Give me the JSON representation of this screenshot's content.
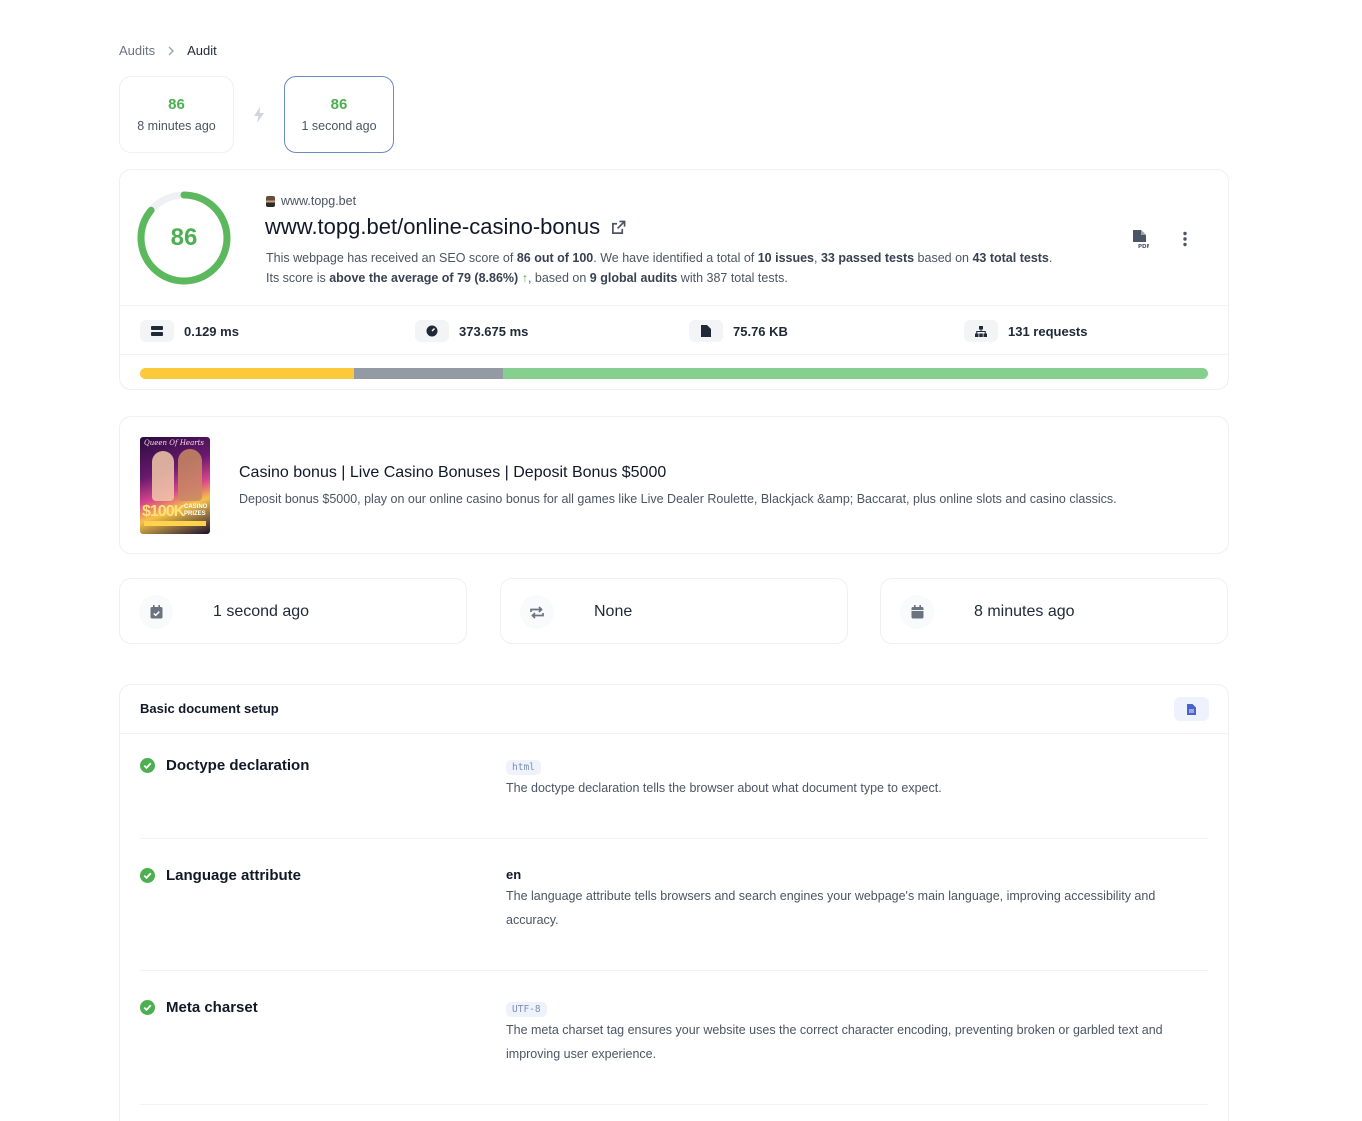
{
  "breadcrumb": {
    "parent": "Audits",
    "current": "Audit"
  },
  "history": [
    {
      "score": "86",
      "time": "8 minutes ago"
    },
    {
      "score": "86",
      "time": "1 second ago"
    }
  ],
  "summary": {
    "score": "86",
    "score_fraction": 0.86,
    "site": "www.topg.bet",
    "url": "www.topg.bet/online-casino-bonus",
    "line1": {
      "p1": "This webpage has received an SEO score of ",
      "b1": "86 out of 100",
      "p2": ". We have identified a total of ",
      "b2": "10 issues",
      "p3": ", ",
      "b3": "33 passed tests",
      "p4": " based on ",
      "b4": "43 total tests",
      "p5": "."
    },
    "line2": {
      "p1": "Its score is ",
      "b1": "above the average of 79 (8.86%)",
      "arrow": "↑",
      "p2": ", based on ",
      "b2": "9 global audits",
      "p3": " with 387 total tests."
    },
    "metrics": [
      {
        "icon": "server-icon",
        "value": "0.129 ms"
      },
      {
        "icon": "gauge-icon",
        "value": "373.675 ms"
      },
      {
        "icon": "file-icon",
        "value": "75.76 KB"
      },
      {
        "icon": "sitemap-icon",
        "value": "131 requests"
      }
    ],
    "issue_bar": {
      "issues": 10,
      "warnings": 7,
      "passed": 33
    }
  },
  "meta": {
    "thumb_text_top": "Queen Of Hearts",
    "thumb_amount": "$100K",
    "thumb_prizes": "CASINO PRIZES",
    "title": "Casino bonus | Live Casino Bonuses | Deposit Bonus $5000",
    "description": "Deposit bonus $5000, play on our online casino bonus for all games like Live Dealer Roulette, Blackjack &amp; Baccarat, plus online slots and casino classics."
  },
  "info_cards": [
    {
      "icon": "calendar-check-icon",
      "text": "1 second ago"
    },
    {
      "icon": "repeat-icon",
      "text": "None"
    },
    {
      "icon": "calendar-icon",
      "text": "8 minutes ago"
    }
  ],
  "section": {
    "title": "Basic document setup",
    "checks": [
      {
        "name": "Doctype declaration",
        "value": "html",
        "value_style": "code",
        "description": "The doctype declaration tells the browser about what document type to expect."
      },
      {
        "name": "Language attribute",
        "value": "en",
        "value_style": "plain",
        "description": "The language attribute tells browsers and search engines your webpage's main language, improving accessibility and accuracy."
      },
      {
        "name": "Meta charset",
        "value": "UTF-8",
        "value_style": "code",
        "description": "The meta charset tag ensures your website uses the correct character encoding, preventing broken or garbled text and improving user experience."
      }
    ]
  },
  "colors": {
    "good": "#4caf50",
    "issues": "#fcc93a",
    "warnings": "#949aa3",
    "passed": "#86d08f",
    "active_border": "#6a8bc0"
  }
}
